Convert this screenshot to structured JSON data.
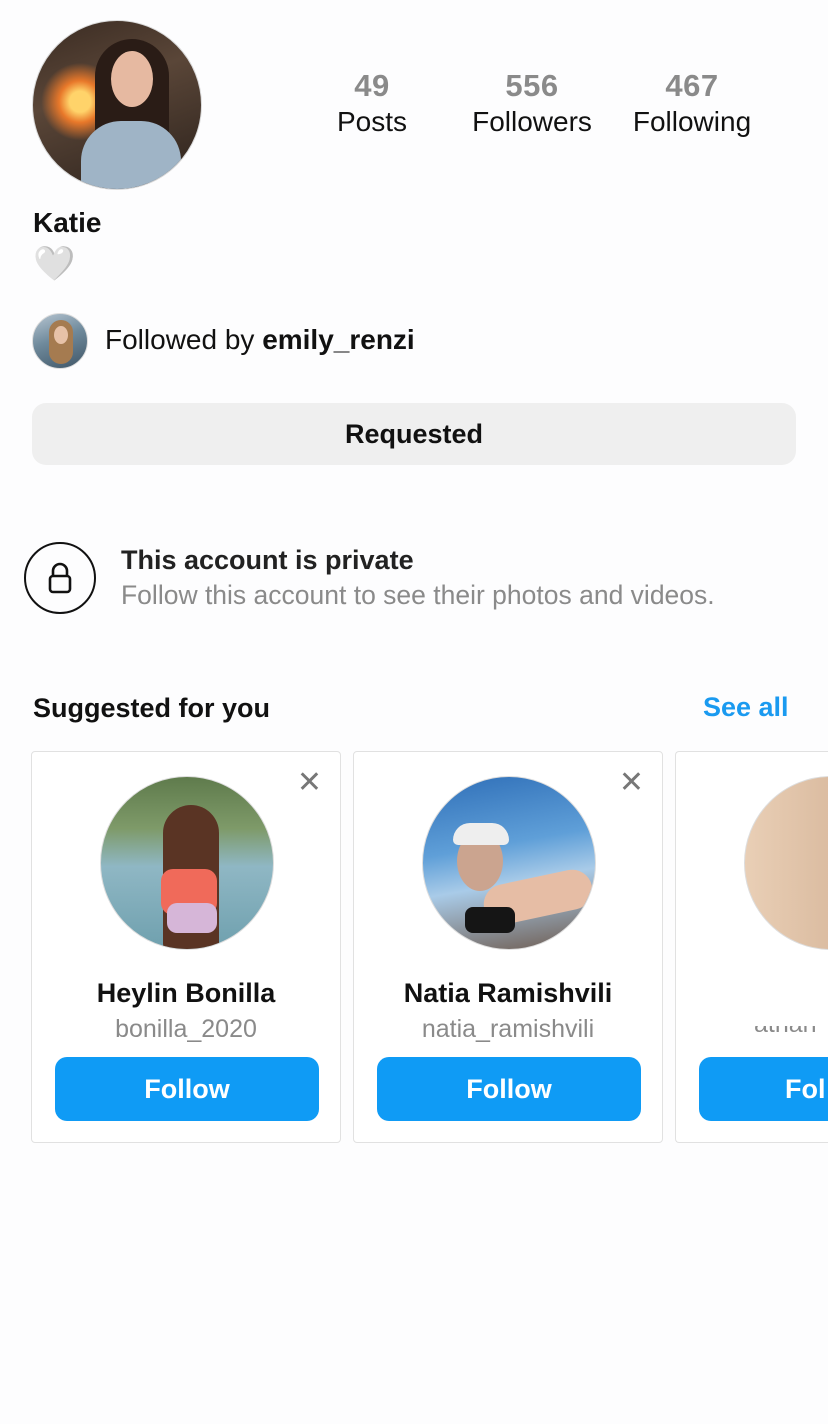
{
  "profile": {
    "name": "Katie",
    "bio_emoji": "🤍",
    "stats": [
      {
        "value": "49",
        "label": "Posts"
      },
      {
        "value": "556",
        "label": "Followers"
      },
      {
        "value": "467",
        "label": "Following"
      }
    ],
    "followed_by_prefix": "Followed by ",
    "followed_by_user": "emily_renzi",
    "requested_label": "Requested"
  },
  "private": {
    "title": "This account is private",
    "subtitle": "Follow this account to see their photos and videos."
  },
  "suggested": {
    "title": "Suggested for you",
    "see_all": "See all",
    "close_glyph": "✕",
    "cards": [
      {
        "name": "Heylin Bonilla",
        "username": "bonilla_2020",
        "button": "Follow"
      },
      {
        "name": "Natia Ramishvili",
        "username": "natia_ramishvili",
        "button": "Follow"
      },
      {
        "name": "",
        "username": "atharr",
        "button": "Fol"
      }
    ]
  },
  "colors": {
    "accent": "#0f9bf5",
    "muted_text": "#8a8a8a",
    "button_bg": "#efefef"
  }
}
